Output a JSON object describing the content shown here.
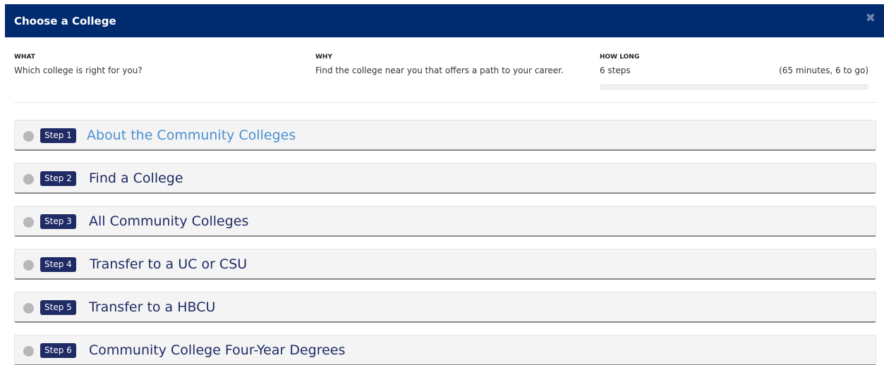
{
  "dialog": {
    "title": "Choose a College",
    "close_icon": "close-icon"
  },
  "info": {
    "what_label": "WHAT",
    "what_text": "Which college is right for you?",
    "why_label": "WHY",
    "why_text": "Find the college near you that offers a path to your career.",
    "how_label": "HOW LONG",
    "how_steps": "6 steps",
    "how_time": "(65 minutes, 6 to go)",
    "progress_fraction": 0
  },
  "steps": [
    {
      "badge": "Step 1",
      "title": "About the Community Colleges",
      "active": true
    },
    {
      "badge": "Step 2",
      "title": "Find a College",
      "active": false
    },
    {
      "badge": "Step 3",
      "title": "All Community Colleges",
      "active": false
    },
    {
      "badge": "Step 4",
      "title": "Transfer to a UC or CSU",
      "active": false
    },
    {
      "badge": "Step 5",
      "title": "Transfer to a HBCU",
      "active": false
    },
    {
      "badge": "Step 6",
      "title": "Community College Four-Year Degrees",
      "active": false
    }
  ],
  "colors": {
    "header_bg": "#002b6e",
    "badge_bg": "#1f2b64",
    "active_link": "#4a90d0",
    "status_dot": "#b8b8b8"
  }
}
